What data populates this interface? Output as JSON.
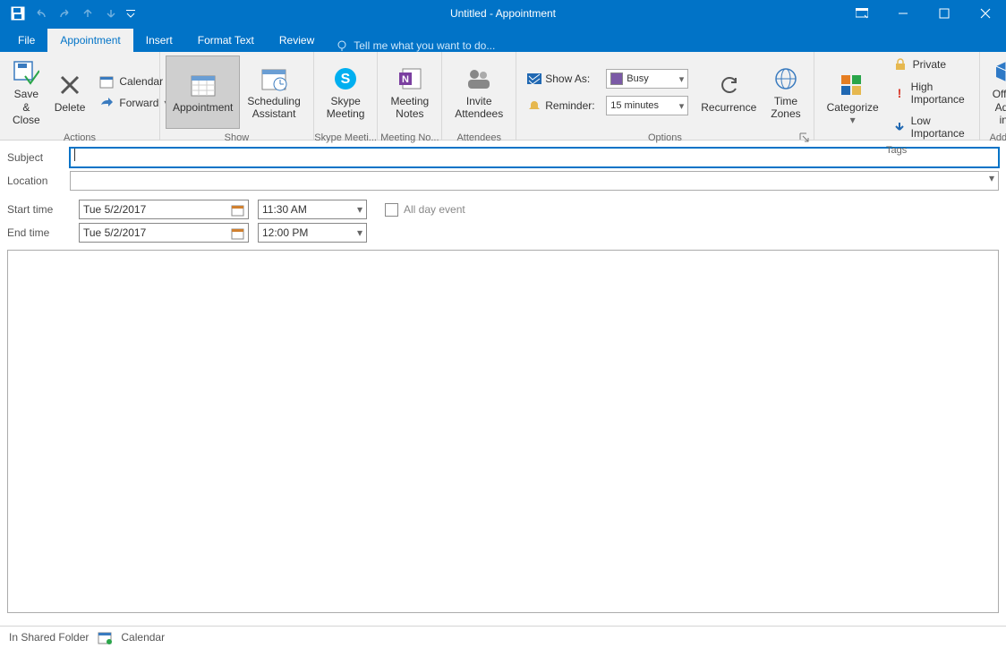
{
  "window_title": "Untitled - Appointment",
  "tabs": {
    "file": "File",
    "appointment": "Appointment",
    "insert": "Insert",
    "format": "Format Text",
    "review": "Review"
  },
  "tellme": "Tell me what you want to do...",
  "groups": {
    "actions": {
      "label": "Actions",
      "save_close": "Save &\nClose",
      "delete": "Delete",
      "calendar": "Calendar",
      "forward": "Forward"
    },
    "show": {
      "label": "Show",
      "appointment": "Appointment",
      "scheduling": "Scheduling\nAssistant"
    },
    "skype": {
      "label": "Skype Meeti...",
      "btn": "Skype\nMeeting"
    },
    "notes": {
      "label": "Meeting No...",
      "btn": "Meeting\nNotes"
    },
    "attendees": {
      "label": "Attendees",
      "btn": "Invite\nAttendees"
    },
    "options": {
      "label": "Options",
      "showas": "Show As:",
      "showas_val": "Busy",
      "reminder": "Reminder:",
      "reminder_val": "15 minutes",
      "recurrence": "Recurrence",
      "timezones": "Time\nZones"
    },
    "tags": {
      "label": "Tags",
      "categorize": "Categorize",
      "private": "Private",
      "high": "High Importance",
      "low": "Low Importance"
    },
    "addins": {
      "label": "Add-ins",
      "btn": "Office\nAdd-ins"
    }
  },
  "form": {
    "subject_label": "Subject",
    "location_label": "Location",
    "start_label": "Start time",
    "end_label": "End time",
    "start_date": "Tue 5/2/2017",
    "end_date": "Tue 5/2/2017",
    "start_time": "11:30 AM",
    "end_time": "12:00 PM",
    "allday": "All day event"
  },
  "status": {
    "folder": "In Shared Folder",
    "calendar": "Calendar"
  }
}
